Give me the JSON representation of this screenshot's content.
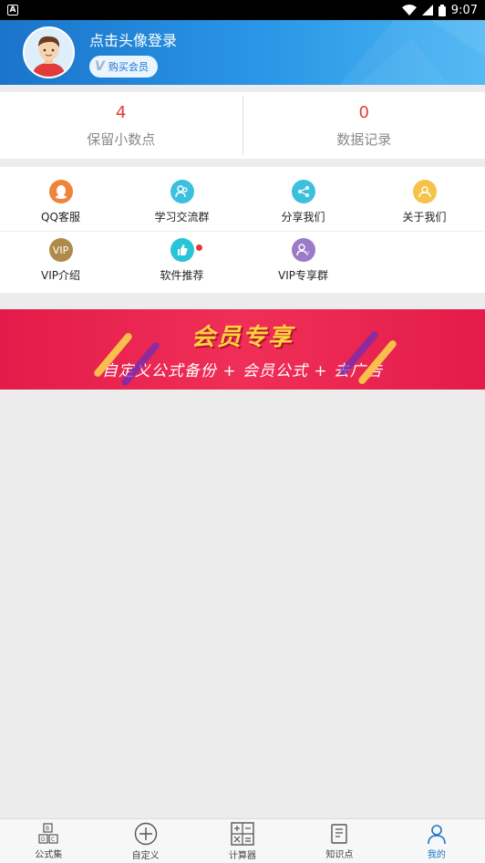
{
  "statusbar": {
    "time": "9:07",
    "app_icon_letter": "A"
  },
  "header": {
    "login_text": "点击头像登录",
    "vip_button_label": "购买会员",
    "vip_button_icon": "V"
  },
  "stats": [
    {
      "value": "4",
      "label": "保留小数点"
    },
    {
      "value": "0",
      "label": "数据记录"
    }
  ],
  "menu_rows": [
    [
      {
        "label": "QQ客服",
        "icon": "qq-icon",
        "color": "#f0833a"
      },
      {
        "label": "学习交流群",
        "icon": "group-icon",
        "color": "#3cc0de"
      },
      {
        "label": "分享我们",
        "icon": "share-icon",
        "color": "#3cc0de"
      },
      {
        "label": "关于我们",
        "icon": "user-icon",
        "color": "#f5c34a"
      }
    ],
    [
      {
        "label": "VIP介绍",
        "icon": "vip-icon",
        "color": "#b08a4a",
        "text": "VIP"
      },
      {
        "label": "软件推荐",
        "icon": "thumbs-up-icon",
        "color": "#28c4d8",
        "badge": true
      },
      {
        "label": "VIP专享群",
        "icon": "vip-group-icon",
        "color": "#9b7bc6"
      }
    ]
  ],
  "banner": {
    "title": "会员专享",
    "subtitle": "自定义公式备份 + 会员公式 + 去广告"
  },
  "bottom_nav": [
    {
      "label": "公式集",
      "icon": "abcd-icon"
    },
    {
      "label": "自定义",
      "icon": "plus-circle-icon"
    },
    {
      "label": "计算器",
      "icon": "calculator-icon"
    },
    {
      "label": "知识点",
      "icon": "book-icon"
    },
    {
      "label": "我的",
      "icon": "profile-icon"
    }
  ],
  "colors": {
    "accent": "#1b74c9",
    "stat_value": "#e53935",
    "banner_bg": "#e41b4a",
    "banner_title": "#ffd23f"
  }
}
